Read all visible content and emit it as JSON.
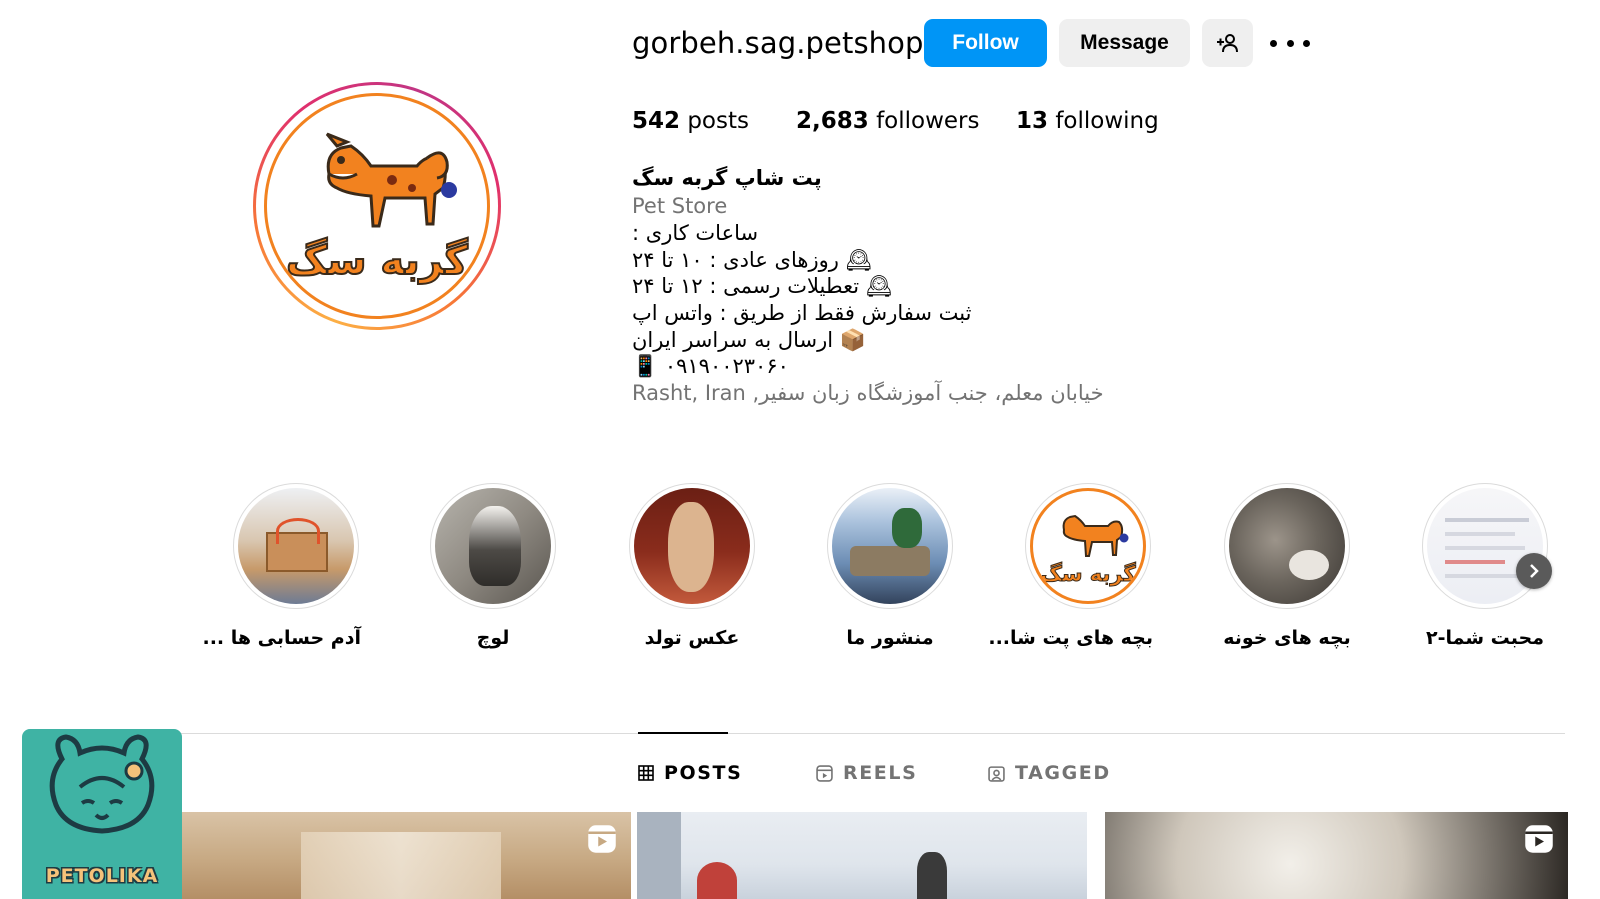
{
  "profile": {
    "username": "gorbeh.sag.petshop",
    "avatar_logo_text": "گربه سگ",
    "follow_label": "Follow",
    "message_label": "Message",
    "stats": {
      "posts_count": "542",
      "posts_label": "posts",
      "followers_count": "2,683",
      "followers_label": "followers",
      "following_count": "13",
      "following_label": "following"
    },
    "bio": {
      "name": "پت شاپ گربه سگ",
      "category": "Pet Store",
      "lines": [
        "ساعات کاری :",
        "🕰 روزهای عادی : ۱۰ تا ۲۴",
        "🕰 تعطیلات رسمی : ۱۲ تا ۲۴",
        "ثبت سفارش فقط از طریق : واتس اپ",
        "📦 ارسال به سراسر ایران",
        "📱 ۰۹۱۹۰۰۲۳۰۶۰"
      ],
      "location": "خیابان معلم، جنب آموزشگاه زبان سفیر, Rasht, Iran"
    }
  },
  "highlights": [
    {
      "label": "آدم حسابی ها ..."
    },
    {
      "label": "لوچ"
    },
    {
      "label": "عکس تولد"
    },
    {
      "label": "منشور ما"
    },
    {
      "label": "بچه های پت شا..."
    },
    {
      "label": "بچه های خونه"
    },
    {
      "label": "محبت شما-۲"
    }
  ],
  "tabs": {
    "posts": "POSTS",
    "reels": "REELS",
    "tagged": "TAGGED"
  },
  "watermark": {
    "text": "PETOLIKA"
  },
  "colors": {
    "follow_blue": "#0095f6",
    "logo_orange": "#f2821f",
    "watermark_teal": "#3fb3a4"
  }
}
